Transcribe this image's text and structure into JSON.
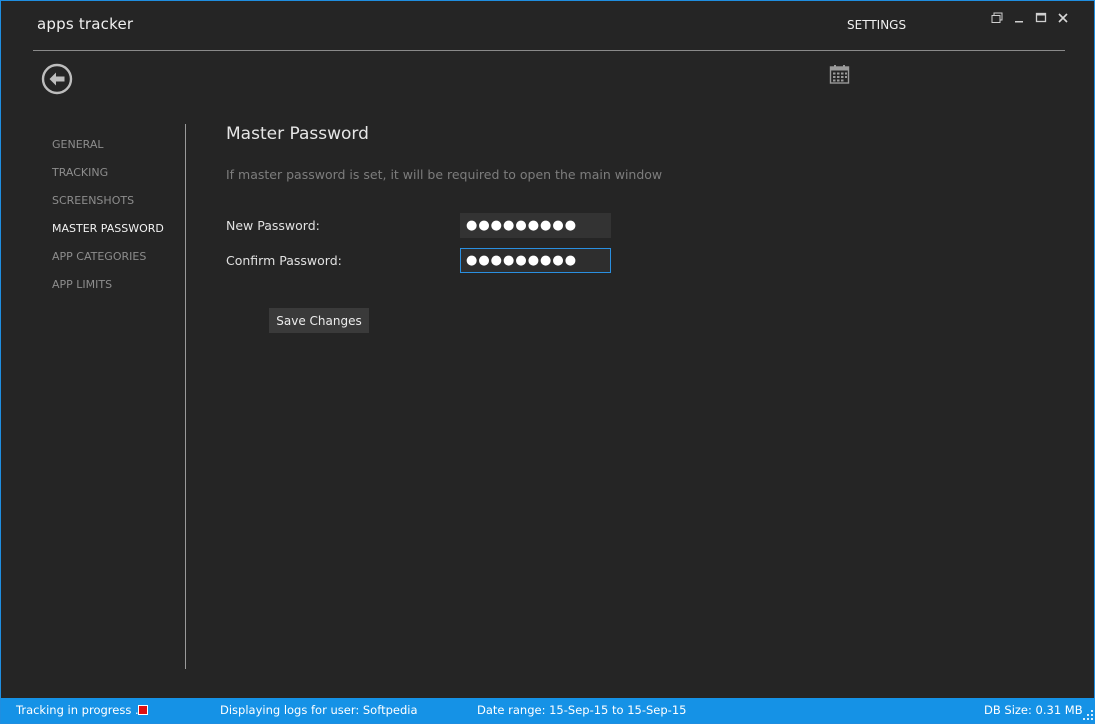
{
  "app": {
    "title": "apps tracker"
  },
  "header": {
    "section_label": "SETTINGS"
  },
  "window_controls": [
    {
      "name": "restore-icon"
    },
    {
      "name": "minimize-icon"
    },
    {
      "name": "maximize-icon"
    },
    {
      "name": "close-icon"
    }
  ],
  "icons": {
    "back": "back-arrow-icon",
    "calendar": "calendar-icon"
  },
  "sidebar": {
    "items": [
      {
        "label": "GENERAL",
        "active": false
      },
      {
        "label": "TRACKING",
        "active": false
      },
      {
        "label": "SCREENSHOTS",
        "active": false
      },
      {
        "label": "MASTER PASSWORD",
        "active": true
      },
      {
        "label": "APP CATEGORIES",
        "active": false
      },
      {
        "label": "APP LIMITS",
        "active": false
      }
    ]
  },
  "main": {
    "title": "Master Password",
    "description": "If master password is set, it will be required to open the main window",
    "new_password_label": "New Password:",
    "new_password_value": "●●●●●●●●●",
    "confirm_password_label": "Confirm Password:",
    "confirm_password_value": "●●●●●●●●●",
    "save_label": "Save Changes"
  },
  "statusbar": {
    "tracking": "Tracking in progress ...",
    "user": "Displaying logs for user: Softpedia",
    "date_range": "Date range: 15-Sep-15 to 15-Sep-15",
    "db_size": "DB Size: 0.31 MB"
  },
  "colors": {
    "accent": "#1592e6",
    "background": "#252525",
    "recording": "#e01010"
  }
}
